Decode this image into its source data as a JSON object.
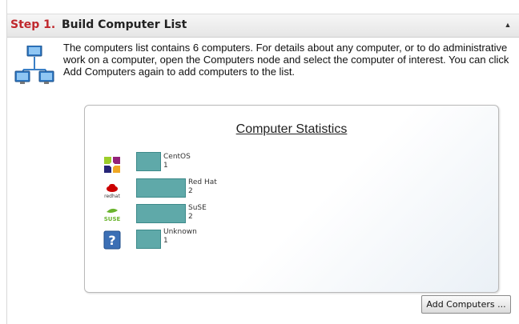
{
  "step": {
    "number_label": "Step 1.",
    "title": "Build Computer List",
    "collapse_glyph": "▲",
    "description": "The computers list contains 6 computers. For details about any computer, or to do administrative work on a computer, open the Computers node and select the computer of interest. You can click Add Computers again to add computers to the list."
  },
  "stats": {
    "title": "Computer Statistics",
    "rows": [
      {
        "name": "CentOS",
        "count": "1",
        "icon": "centos-icon"
      },
      {
        "name": "Red Hat",
        "count": "2",
        "icon": "redhat-icon"
      },
      {
        "name": "SuSE",
        "count": "2",
        "icon": "suse-icon"
      },
      {
        "name": "Unknown",
        "count": "1",
        "icon": "unknown-os-icon"
      }
    ],
    "redhat_logo_text": "redhat",
    "suse_logo_text": "SUSE",
    "unknown_logo_text": "?"
  },
  "chart_data": {
    "type": "bar",
    "title": "Computer Statistics",
    "categories": [
      "CentOS",
      "Red Hat",
      "SuSE",
      "Unknown"
    ],
    "values": [
      1,
      2,
      2,
      1
    ]
  },
  "actions": {
    "add_computers_label": "Add Computers ..."
  },
  "colors": {
    "bar": "#5fa9a9",
    "step_number": "#c0282d"
  }
}
